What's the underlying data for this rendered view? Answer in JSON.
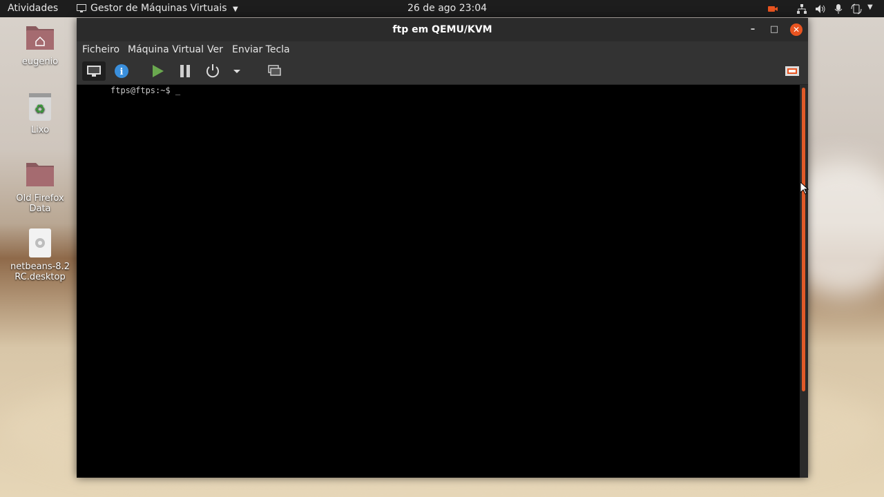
{
  "topbar": {
    "activities": "Atividades",
    "app_menu": "Gestor de Máquinas Virtuais",
    "clock": "26 de ago  23:04"
  },
  "desktop": {
    "icons": [
      {
        "label": "eugenio",
        "icon": "home-folder-icon"
      },
      {
        "label": "Lixo",
        "icon": "trash-icon"
      },
      {
        "label": "Old Firefox Data",
        "icon": "folder-icon"
      },
      {
        "label": "netbeans-8.2\nRC.desktop",
        "icon": "gear-icon"
      }
    ]
  },
  "window": {
    "title": "ftp em QEMU/KVM",
    "menu": [
      "Ficheiro",
      "Máquina Virtual",
      "Ver",
      "Enviar Tecla"
    ],
    "console_text": "ftps@ftps:~$ _"
  },
  "colors": {
    "accent": "#e95420",
    "topbar_bg": "#1d1d1d",
    "window_bg": "#333333"
  }
}
